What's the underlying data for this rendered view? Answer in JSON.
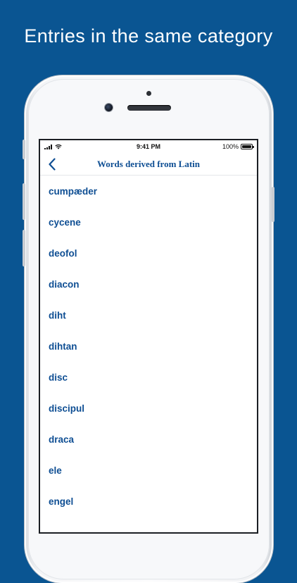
{
  "headline": "Entries in the same category",
  "status_bar": {
    "time": "9:41 PM",
    "battery_text": "100%",
    "battery_level": 1.0
  },
  "nav": {
    "back_icon": "chevron-left-icon",
    "title": "Words derived from Latin"
  },
  "entries": [
    "cumpæder",
    "cycene",
    "deofol",
    "diacon",
    "diht",
    "dihtan",
    "disc",
    "discipul",
    "draca",
    "ele",
    "engel"
  ],
  "colors": {
    "background": "#0a5592",
    "accent": "#0e4e93",
    "text_on_background": "#ffffff"
  }
}
